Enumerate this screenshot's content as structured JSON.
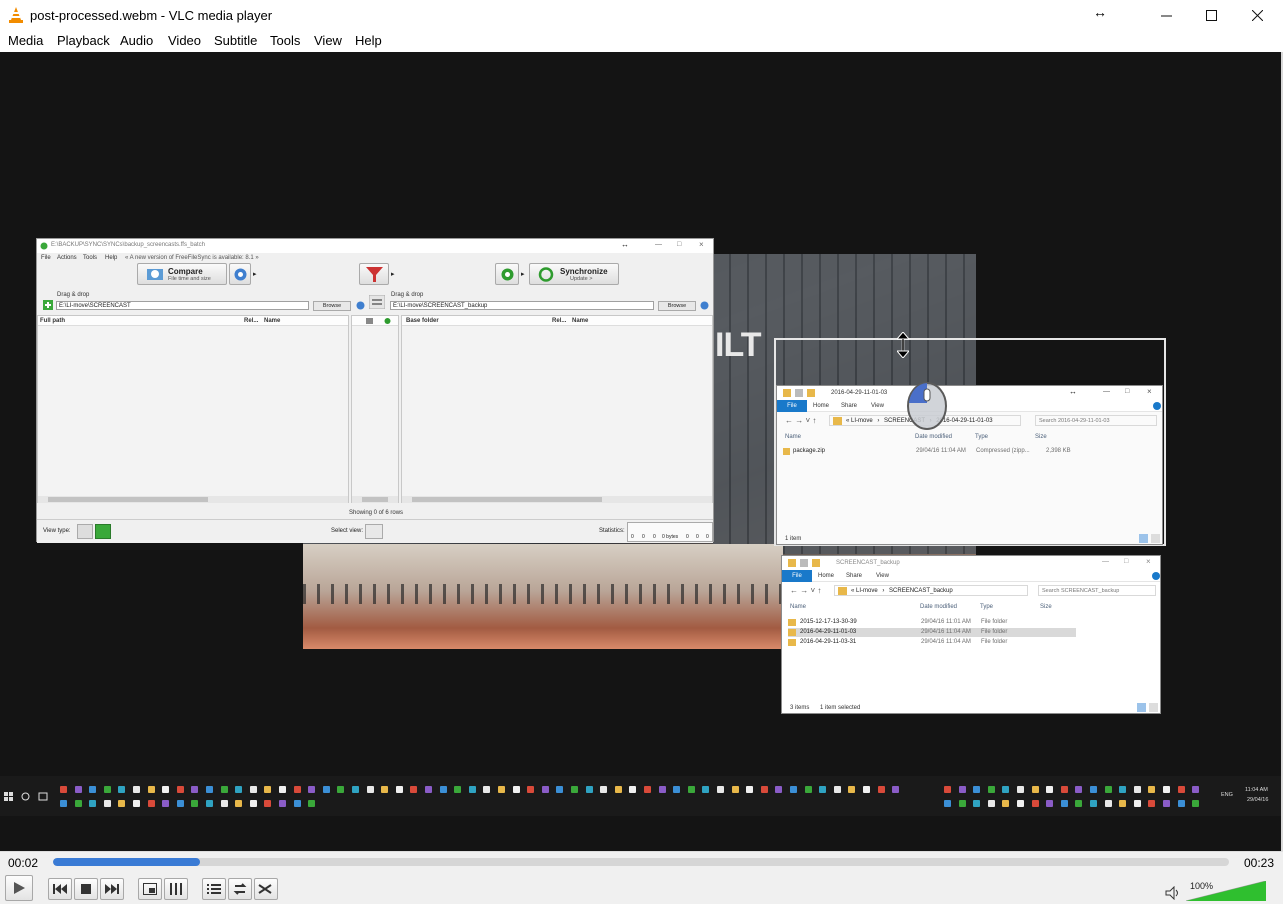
{
  "window": {
    "title": "post-processed.webm - VLC media player"
  },
  "menu": [
    "Media",
    "Playback",
    "Audio",
    "Video",
    "Subtitle",
    "Tools",
    "View",
    "Help"
  ],
  "video_content": {
    "ffs": {
      "title": "E:\\BACKUP\\SYNC\\SYNCs\\backup_screencasts.ffs_batch",
      "menu": [
        "File",
        "Actions",
        "Tools",
        "Help",
        "« A new version of FreeFileSync is available: 8.1 »"
      ],
      "compare_label": "Compare",
      "compare_sub": "File time and size",
      "sync_label": "Synchronize",
      "sync_sub": "Update >",
      "left_drag": "Drag & drop",
      "left_path": "E:\\LI-move\\SCREENCAST",
      "right_drag": "Drag & drop",
      "right_path": "E:\\LI-move\\SCREENCAST_backup",
      "browse": "Browse",
      "left_headers": [
        "Full path",
        "Rel...",
        "Name"
      ],
      "right_headers": [
        "Base folder",
        "Rel...",
        "Name"
      ],
      "status": "Showing 0 of 6 rows",
      "view_type": "View type:",
      "select_view": "Select view:",
      "statistics": "Statistics:",
      "stats_values": [
        "0",
        "0",
        "0",
        "0 bytes",
        "0",
        "0",
        "0"
      ]
    },
    "explorer_top": {
      "title": "2016-04-29-11-01-03",
      "tabs": [
        "File",
        "Home",
        "Share",
        "View"
      ],
      "address": [
        "« LI-move",
        "SCREENCAST",
        "2016-04-29-11-01-03"
      ],
      "search": "Search 2016-04-29-11-01-03",
      "columns": [
        "Name",
        "Date modified",
        "Type",
        "Size"
      ],
      "rows": [
        {
          "name": "package.zip",
          "date": "29/04/16 11:04 AM",
          "type": "Compressed (zipp...",
          "size": "2,398 KB"
        }
      ],
      "footer": "1 item"
    },
    "explorer_bottom": {
      "title": "SCREENCAST_backup",
      "tabs": [
        "File",
        "Home",
        "Share",
        "View"
      ],
      "address": [
        "« LI-move",
        "SCREENCAST_backup"
      ],
      "search": "Search SCREENCAST_backup",
      "columns": [
        "Name",
        "Date modified",
        "Type",
        "Size"
      ],
      "rows": [
        {
          "name": "2015-12-17-13-30-39",
          "date": "29/04/16 11:01 AM",
          "type": "File folder"
        },
        {
          "name": "2016-04-29-11-01-03",
          "date": "29/04/16 11:04 AM",
          "type": "File folder"
        },
        {
          "name": "2016-04-29-11-03-31",
          "date": "29/04/16 11:04 AM",
          "type": "File folder"
        }
      ],
      "footer_items": "3 items",
      "footer_selected": "1 item selected"
    },
    "building_sign": "ILT",
    "taskbar": {
      "lang": "ENG",
      "time": "11:04 AM",
      "date": "29/04/16"
    }
  },
  "controls": {
    "elapsed": "00:02",
    "total": "00:23",
    "progress": 0.125,
    "volume_label": "100%",
    "volume": 1.0
  },
  "colors": {
    "accent": "#3a7bd5",
    "volume": "#2fbf2f",
    "vlc_orange": "#f28c00"
  }
}
